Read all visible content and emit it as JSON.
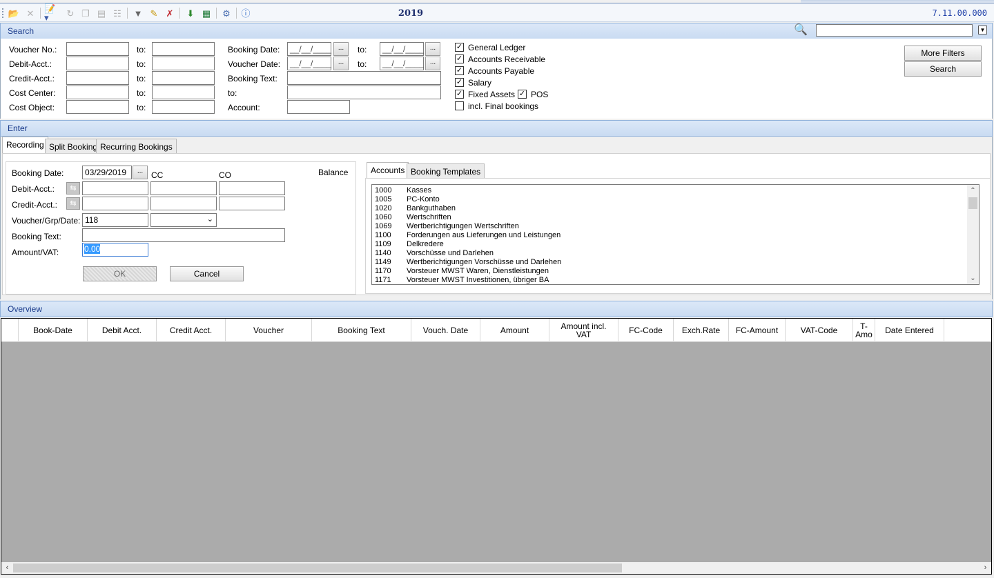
{
  "toolbar": {
    "year": "2019",
    "version": "7.11.00.000",
    "icons": [
      "open-folder-icon",
      "delete-icon",
      "edit-document-icon",
      "refresh-icon",
      "copy-icon",
      "page-icon",
      "book-icon",
      "filter-icon",
      "edit-filter-icon",
      "remove-filter-icon",
      "download-icon",
      "excel-icon",
      "tools-icon",
      "help-icon"
    ]
  },
  "search": {
    "header": "Search",
    "labels": {
      "voucher_no": "Voucher No.:",
      "debit_acct": "Debit-Acct.:",
      "credit_acct": "Credit-Acct.:",
      "cost_center": "Cost Center:",
      "cost_object": "Cost Object:",
      "to": "to:",
      "booking_date": "Booking Date:",
      "voucher_date": "Voucher Date:",
      "booking_text": "Booking Text:",
      "account": "Account:"
    },
    "date_placeholder": "__/__/____",
    "dots": "...",
    "checkboxes": {
      "general_ledger": "General Ledger",
      "accounts_receivable": "Accounts Receivable",
      "accounts_payable": "Accounts Payable",
      "salary": "Salary",
      "fixed_assets": "Fixed Assets",
      "pos": "POS",
      "final_bookings": "incl. Final bookings"
    },
    "more_filters": "More Filters",
    "search_button": "Search"
  },
  "enter": {
    "header": "Enter",
    "tabs": [
      "Recording",
      "Split Booking",
      "Recurring Bookings"
    ],
    "recording": {
      "booking_date_label": "Booking Date:",
      "booking_date_value": "03/29/2019",
      "cc": "CC",
      "co": "CO",
      "balance": "Balance",
      "debit_label": "Debit-Acct.:",
      "credit_label": "Credit-Acct.:",
      "voucher_label": "Voucher/Grp/Date:",
      "voucher_value": "118",
      "booking_text_label": "Booking Text:",
      "amount_label": "Amount/VAT:",
      "amount_value": "0.00",
      "ok": "OK",
      "cancel": "Cancel"
    },
    "right_tabs": [
      "Accounts",
      "Booking Templates"
    ],
    "accounts": [
      {
        "num": "1000",
        "name": "Kasses"
      },
      {
        "num": "1005",
        "name": "PC-Konto"
      },
      {
        "num": "1020",
        "name": "Bankguthaben"
      },
      {
        "num": "1060",
        "name": "Wertschriften"
      },
      {
        "num": "1069",
        "name": "Wertberichtigungen Wertschriften"
      },
      {
        "num": "1100",
        "name": "Forderungen aus Lieferungen und Leistungen"
      },
      {
        "num": "1109",
        "name": "Delkredere"
      },
      {
        "num": "1140",
        "name": "Vorschüsse und Darlehen"
      },
      {
        "num": "1149",
        "name": "Wertberichtigungen Vorschüsse und Darlehen"
      },
      {
        "num": "1170",
        "name": "Vorsteuer MWST Waren, Dienstleistungen"
      },
      {
        "num": "1171",
        "name": "Vorsteuer MWST Investitionen, übriger BA"
      }
    ]
  },
  "overview": {
    "header": "Overview",
    "columns": [
      "Book-Date",
      "Debit Acct.",
      "Credit Acct.",
      "Voucher",
      "Booking Text",
      "Vouch. Date",
      "Amount",
      "Amount incl.\nVAT",
      "FC-Code",
      "Exch.Rate",
      "FC-Amount",
      "VAT-Code",
      "T-Amo",
      "Date Entered"
    ]
  }
}
